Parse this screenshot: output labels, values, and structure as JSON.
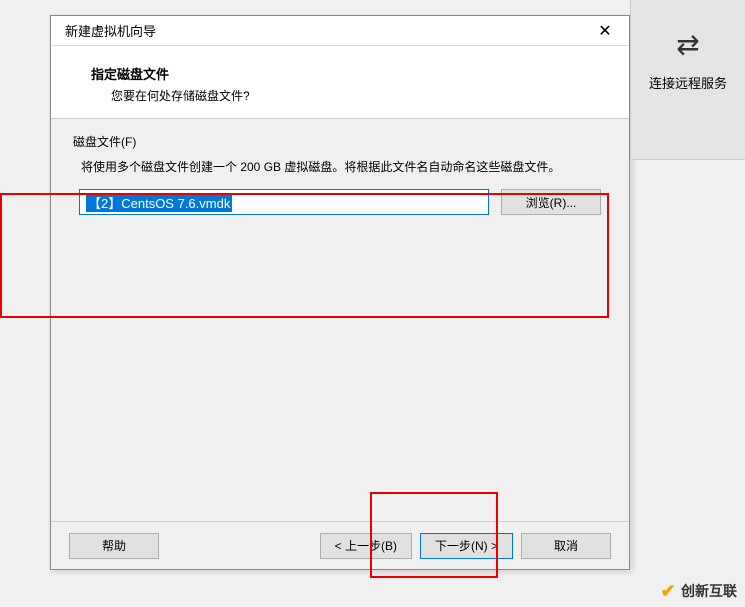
{
  "dialog": {
    "title": "新建虚拟机向导",
    "header_title": "指定磁盘文件",
    "header_subtitle": "您要在何处存储磁盘文件?"
  },
  "disk_section": {
    "label": "磁盘文件(F)",
    "description": "将使用多个磁盘文件创建一个 200 GB 虚拟磁盘。将根据此文件名自动命名这些磁盘文件。",
    "filename": "【2】CentsOS 7.6.vmdk",
    "browse_label": "浏览(R)..."
  },
  "footer": {
    "help": "帮助",
    "back": "< 上一步(B)",
    "next": "下一步(N) >",
    "cancel": "取消"
  },
  "side_panel": {
    "label": "连接远程服务"
  },
  "watermark": {
    "text": "创新互联"
  }
}
